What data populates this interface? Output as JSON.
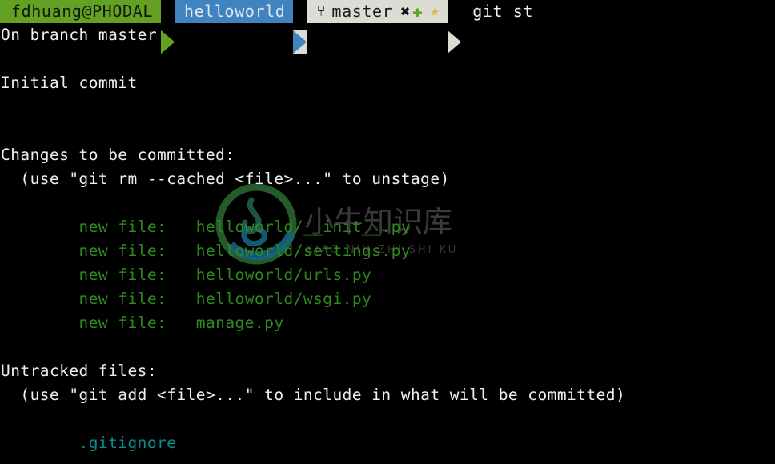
{
  "terminal": {
    "background": "#000000",
    "foreground": "#f0f0f0",
    "green": "#2f8a1e",
    "teal": "#0b8a8f"
  },
  "prompt": {
    "user_segment": {
      "label": "fdhuang@PHODAL",
      "background": "#64a021",
      "foreground": "#101810"
    },
    "dir_segment": {
      "label": "helloworld",
      "background": "#4083bf",
      "foreground": "#dce9f4"
    },
    "git_segment": {
      "branch_icon": "⑂",
      "branch": "master",
      "flag_modified": "✖",
      "flag_staged": "✚",
      "flag_stashed": "★",
      "background": "#dcdcd4",
      "foreground": "#1a1a1a",
      "staged_color": "#55aa22",
      "stashed_color": "#d8b840"
    },
    "command": "git st"
  },
  "output": {
    "lines": [
      {
        "text": "On branch master",
        "color": "white"
      },
      {
        "text": "",
        "color": "white"
      },
      {
        "text": "Initial commit",
        "color": "white"
      },
      {
        "text": "",
        "color": "white"
      },
      {
        "text": "",
        "color": "white"
      },
      {
        "text": "Changes to be committed:",
        "color": "white"
      },
      {
        "text": "  (use \"git rm --cached <file>...\" to unstage)",
        "color": "white"
      },
      {
        "text": "",
        "color": "white"
      },
      {
        "text": "        new file:   helloworld/__init__.py",
        "color": "green"
      },
      {
        "text": "        new file:   helloworld/settings.py",
        "color": "green"
      },
      {
        "text": "        new file:   helloworld/urls.py",
        "color": "green"
      },
      {
        "text": "        new file:   helloworld/wsgi.py",
        "color": "green"
      },
      {
        "text": "        new file:   manage.py",
        "color": "green"
      },
      {
        "text": "",
        "color": "white"
      },
      {
        "text": "Untracked files:",
        "color": "white"
      },
      {
        "text": "  (use \"git add <file>...\" to include in what will be committed)",
        "color": "white"
      },
      {
        "text": "",
        "color": "white"
      },
      {
        "text": "        .gitignore",
        "color": "teal"
      }
    ]
  },
  "watermark": {
    "cjk_text": "小牛知识库",
    "pinyin_text": "XIAO NIU ZHI SHI KU",
    "logo_outer_color": "#2c6b33",
    "logo_inner_color": "#15637f",
    "text_color": "#3a3a3a"
  }
}
